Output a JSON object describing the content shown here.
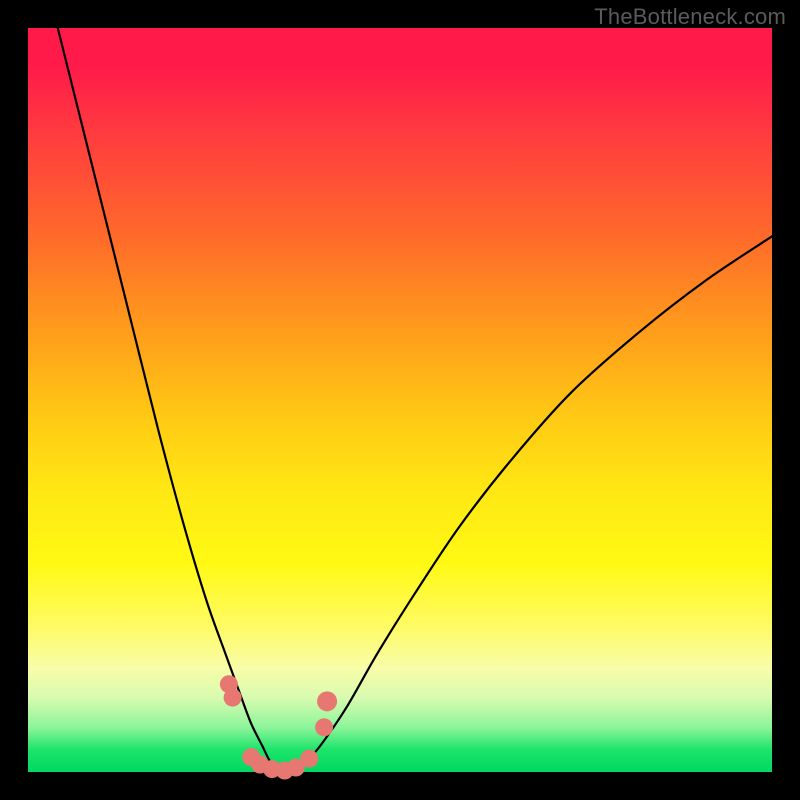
{
  "watermark": "TheBottleneck.com",
  "chart_data": {
    "type": "line",
    "title": "",
    "xlabel": "",
    "ylabel": "",
    "xlim": [
      0,
      1
    ],
    "ylim": [
      0,
      1
    ],
    "grid": false,
    "legend": false,
    "annotations": [],
    "series": [
      {
        "name": "curve",
        "x": [
          0.04,
          0.09,
          0.135,
          0.175,
          0.21,
          0.24,
          0.265,
          0.285,
          0.3,
          0.315,
          0.325,
          0.335,
          0.345,
          0.36,
          0.38,
          0.4,
          0.43,
          0.47,
          0.52,
          0.58,
          0.65,
          0.73,
          0.82,
          0.91,
          1.0
        ],
        "y": [
          1.0,
          0.8,
          0.62,
          0.46,
          0.33,
          0.23,
          0.16,
          0.105,
          0.065,
          0.035,
          0.015,
          0.005,
          0.0,
          0.005,
          0.02,
          0.045,
          0.09,
          0.16,
          0.24,
          0.33,
          0.42,
          0.51,
          0.59,
          0.66,
          0.72
        ]
      }
    ],
    "markers": {
      "name": "highlighted-points",
      "color": "#e77771",
      "x": [
        0.27,
        0.275,
        0.3,
        0.312,
        0.328,
        0.345,
        0.36,
        0.378,
        0.398,
        0.402
      ],
      "y": [
        0.118,
        0.1,
        0.02,
        0.01,
        0.004,
        0.002,
        0.006,
        0.018,
        0.06,
        0.095
      ],
      "r": [
        9,
        9,
        9,
        9,
        9,
        9,
        9,
        9,
        9,
        10
      ]
    },
    "background_gradient": {
      "top": "#ff1a4a",
      "mid": "#fff914",
      "bottom": "#00d860"
    }
  }
}
